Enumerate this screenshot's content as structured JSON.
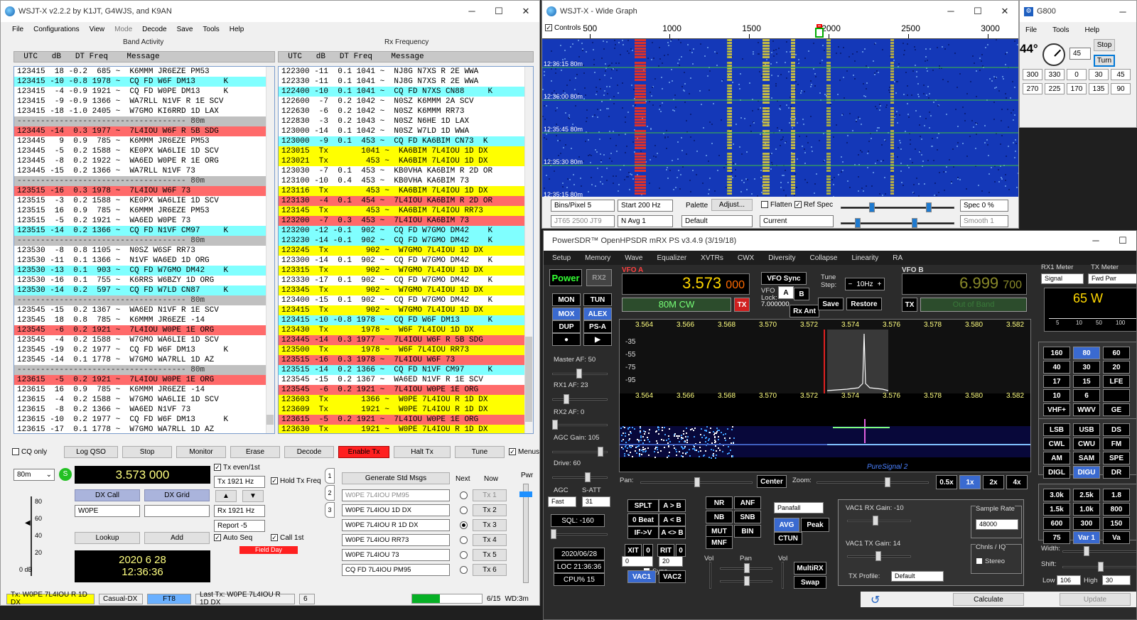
{
  "wsjt": {
    "title": "WSJT-X   v2.2.2   by K1JT, G4WJS, and K9AN",
    "menu": [
      "File",
      "Configurations",
      "View",
      "Mode",
      "Decode",
      "Save",
      "Tools",
      "Help"
    ],
    "band_activity_label": "Band Activity",
    "rx_frequency_label": "Rx Frequency",
    "col_header": "  UTC   dB   DT Freq    Message",
    "band_rows": [
      {
        "t": "123415  18 -0.2  685 ~  K6MMM JR6EZE PM53",
        "c": ""
      },
      {
        "t": "123415 -10 -0.8 1978 ~  CQ FD W6F DM13      K",
        "c": "cq"
      },
      {
        "t": "123415  -4 -0.9 1921 ~  CQ FD W0PE DM13     K",
        "c": ""
      },
      {
        "t": "123415  -9 -0.9 1366 ~  WA7RLL N1VF R 1E SCV",
        "c": ""
      },
      {
        "t": "123415 -18 -1.0 2405 ~  W7GMO KI6RRD 1D LAX",
        "c": ""
      },
      {
        "t": "------------------------------------ 80m",
        "c": "sep"
      },
      {
        "t": "123445 -14  0.3 1977 ~  7L4IOU W6F R 5B SDG",
        "c": "me"
      },
      {
        "t": "123445   9  0.9  785 ~  K6MMM JR6EZE PM53",
        "c": ""
      },
      {
        "t": "123445  -5  0.2 1588 ~  KE0PX WA6LIE 1D SCV",
        "c": ""
      },
      {
        "t": "123445  -8  0.2 1922 ~  WA6ED W0PE R 1E ORG",
        "c": ""
      },
      {
        "t": "123445 -15  0.2 1366 ~  WA7RLL N1VF 73",
        "c": ""
      },
      {
        "t": "------------------------------------ 80m",
        "c": "sep"
      },
      {
        "t": "123515 -16  0.3 1978 ~  7L4IOU W6F 73",
        "c": "me"
      },
      {
        "t": "123515  -3  0.2 1588 ~  KE0PX WA6LIE 1D SCV",
        "c": ""
      },
      {
        "t": "123515  16  0.9  785 ~  K6MMM JR6EZE PM53",
        "c": ""
      },
      {
        "t": "123515  -5  0.2 1921 ~  WA6ED W0PE 73",
        "c": ""
      },
      {
        "t": "123515 -14  0.2 1366 ~  CQ FD N1VF CM97     K",
        "c": "cq"
      },
      {
        "t": "------------------------------------ 80m",
        "c": "sep"
      },
      {
        "t": "123530  -8  0.8 1105 ~  N0SZ W6SF RR73",
        "c": ""
      },
      {
        "t": "123530 -11  0.1 1366 ~  N1VF WA6ED 1D ORG",
        "c": ""
      },
      {
        "t": "123530 -13  0.1  903 ~  CQ FD W7GMO DM42    K",
        "c": "cq"
      },
      {
        "t": "123530 -16  0.1  755 ~  K6RRS W6BZY 1D ORG",
        "c": ""
      },
      {
        "t": "123530 -14  0.2  597 ~  CQ FD W7LD CN87     K",
        "c": "cq"
      },
      {
        "t": "------------------------------------ 80m",
        "c": "sep"
      },
      {
        "t": "123545 -15  0.2 1367 ~  WA6ED N1VF R 1E SCV",
        "c": ""
      },
      {
        "t": "123545  18  0.8  785 ~  K6MMM JR6EZE -14",
        "c": ""
      },
      {
        "t": "123545  -6  0.2 1921 ~  7L4IOU W0PE 1E ORG",
        "c": "me"
      },
      {
        "t": "123545  -4  0.2 1588 ~  W7GMO WA6LIE 1D SCV",
        "c": ""
      },
      {
        "t": "123545 -19  0.2 1977 ~  CQ FD W6F DM13      K",
        "c": ""
      },
      {
        "t": "123545 -14  0.1 1778 ~  W7GMO WA7RLL 1D AZ",
        "c": ""
      },
      {
        "t": "------------------------------------ 80m",
        "c": "sep"
      },
      {
        "t": "123615  -5  0.2 1921 ~  7L4IOU W0PE 1E ORG",
        "c": "me"
      },
      {
        "t": "123615  16  0.9  785 ~  K6MMM JR6EZE -14",
        "c": ""
      },
      {
        "t": "123615  -4  0.2 1588 ~  W7GMO WA6LIE 1D SCV",
        "c": ""
      },
      {
        "t": "123615  -8  0.2 1366 ~  WA6ED N1VF 73",
        "c": ""
      },
      {
        "t": "123615 -10  0.2 1977 ~  CQ FD W6F DM13      K",
        "c": ""
      },
      {
        "t": "123615 -17  0.1 1778 ~  W7GMO WA7RLL 1D AZ",
        "c": ""
      }
    ],
    "rx_rows": [
      {
        "t": "122300 -11  0.1 1041 ~  NJ8G N7XS R 2E WWA",
        "c": ""
      },
      {
        "t": "122330 -11  0.1 1041 ~  NJ8G N7XS R 2E WWA",
        "c": ""
      },
      {
        "t": "122400 -10  0.1 1041 ~  CQ FD N7XS CN88     K",
        "c": "cq"
      },
      {
        "t": "122600  -7  0.2 1042 ~  N0SZ K6MMM 2A SCV",
        "c": ""
      },
      {
        "t": "122630  -6  0.2 1042 ~  N0SZ K6MMM RR73",
        "c": ""
      },
      {
        "t": "122830  -3  0.2 1043 ~  N0SZ N6HE 1D LAX",
        "c": ""
      },
      {
        "t": "123000 -14  0.1 1042 ~  N0SZ W7LD 1D WWA",
        "c": ""
      },
      {
        "t": "123000  -9  0.1  453 ~  CQ FD KA6BIM CN73  K",
        "c": "cq"
      },
      {
        "t": "123015  Tx       1041 ~  KA6BIM 7L4IOU 1D DX",
        "c": "tx"
      },
      {
        "t": "123021  Tx        453 ~  KA6BIM 7L4IOU 1D DX",
        "c": "tx"
      },
      {
        "t": "123030  -7  0.1  453 ~  KB0VHA KA6BIM R 2D OR",
        "c": ""
      },
      {
        "t": "123100 -10  0.4  453 ~  KB0VHA KA6BIM 73",
        "c": ""
      },
      {
        "t": "123116  Tx        453 ~  KA6BIM 7L4IOU 1D DX",
        "c": "tx"
      },
      {
        "t": "123130  -4  0.1  454 ~  7L4IOU KA6BIM R 2D OR",
        "c": "me"
      },
      {
        "t": "123145  Tx        453 ~  KA6BIM 7L4IOU RR73",
        "c": "tx"
      },
      {
        "t": "123200  -7  0.3  453 ~  7L4IOU KA6BIM 73",
        "c": "me"
      },
      {
        "t": "123200 -12 -0.1  902 ~  CQ FD W7GMO DM42    K",
        "c": "cq"
      },
      {
        "t": "123230 -14 -0.1  902 ~  CQ FD W7GMO DM42    K",
        "c": "cq"
      },
      {
        "t": "123245  Tx        902 ~  W7GMO 7L4IOU 1D DX",
        "c": "tx"
      },
      {
        "t": "123300 -14  0.1  902 ~  CQ FD W7GMO DM42    K",
        "c": ""
      },
      {
        "t": "123315  Tx        902 ~  W7GMO 7L4IOU 1D DX",
        "c": "tx"
      },
      {
        "t": "123330 -17  0.1  902 ~  CQ FD W7GMO DM42    K",
        "c": ""
      },
      {
        "t": "123345  Tx        902 ~  W7GMO 7L4IOU 1D DX",
        "c": "tx"
      },
      {
        "t": "123400 -15  0.1  902 ~  CQ FD W7GMO DM42    K",
        "c": ""
      },
      {
        "t": "123415  Tx        902 ~  W7GMO 7L4IOU 1D DX",
        "c": "tx"
      },
      {
        "t": "123415 -10 -0.8 1978 ~  CQ FD W6F DM13      K",
        "c": "cq"
      },
      {
        "t": "123430  Tx       1978 ~  W6F 7L4IOU 1D DX",
        "c": "tx"
      },
      {
        "t": "123445 -14  0.3 1977 ~  7L4IOU W6F R 5B SDG",
        "c": "me"
      },
      {
        "t": "123500  Tx       1978 ~  W6F 7L4IOU RR73",
        "c": "tx"
      },
      {
        "t": "123515 -16  0.3 1978 ~  7L4IOU W6F 73",
        "c": "me"
      },
      {
        "t": "123515 -14  0.2 1366 ~  CQ FD N1VF CM97     K",
        "c": "cq"
      },
      {
        "t": "123545 -15  0.2 1367 ~  WA6ED N1VF R 1E SCV",
        "c": ""
      },
      {
        "t": "123545  -6  0.2 1921 ~  7L4IOU W0PE 1E ORG",
        "c": "me"
      },
      {
        "t": "123603  Tx       1366 ~  W0PE 7L4IOU R 1D DX",
        "c": "tx"
      },
      {
        "t": "123609  Tx       1921 ~  W0PE 7L4IOU R 1D DX",
        "c": "tx"
      },
      {
        "t": "123615  -5  0.2 1921 ~  7L4IOU W0PE 1E ORG",
        "c": "me"
      },
      {
        "t": "123630  Tx       1921 ~  W0PE 7L4IOU R 1D DX",
        "c": "tx"
      }
    ],
    "buttons": {
      "cq_only": "CQ only",
      "log_qso": "Log QSO",
      "stop": "Stop",
      "monitor": "Monitor",
      "erase": "Erase",
      "decode": "Decode",
      "enable_tx": "Enable Tx",
      "halt_tx": "Halt Tx",
      "tune": "Tune",
      "menus": "Menus"
    },
    "band": "80m",
    "dial_freq": "3.573 000",
    "dx_call_label": "DX Call",
    "dx_grid_label": "DX Grid",
    "dx_call": "W0PE",
    "dx_grid": "",
    "lookup": "Lookup",
    "add": "Add",
    "date": "2020 6 28",
    "time": "12:36:36",
    "tx_even": "Tx even/1st",
    "tx_hz": "Tx  1921  Hz",
    "rx_hz": "Rx  1921  Hz",
    "hold_tx_freq": "Hold Tx Freq",
    "report": "Report -5",
    "auto_seq": "Auto Seq",
    "call_1st": "Call 1st",
    "field_day": "Field Day",
    "gen_std_msgs": "Generate Std Msgs",
    "next_label": "Next",
    "now_label": "Now",
    "pwr_label": "Pwr",
    "tx_msgs": [
      "W0PE 7L4IOU PM95",
      "W0PE 7L4IOU 1D DX",
      "W0PE 7L4IOU R 1D DX",
      "W0PE 7L4IOU RR73",
      "W0PE 7L4IOU 73",
      "CQ FD 7L4IOU PM95"
    ],
    "tx_btns": [
      "Tx 1",
      "Tx 2",
      "Tx 3",
      "Tx 4",
      "Tx 5",
      "Tx 6"
    ],
    "meter_ticks": [
      "80",
      "60",
      "40",
      "20",
      "0 dB"
    ],
    "side_tabs": [
      "1",
      "2",
      "3"
    ],
    "status": {
      "tx": "Tx: W0PE 7L4IOU R 1D DX",
      "config": "Casual-DX",
      "mode": "FT8",
      "last_tx": "Last Tx: W0PE 7L4IOU R 1D DX",
      "count": "6",
      "progress": "6/15",
      "wd": "WD:3m"
    }
  },
  "wide": {
    "title": "WSJT-X - Wide Graph",
    "controls": "Controls",
    "scale": [
      "500",
      "1000",
      "1500",
      "2000",
      "2500",
      "3000"
    ],
    "time_labels": [
      "12:36:15  80m",
      "12:36:00  80m",
      "12:35:45  80m",
      "12:35:30  80m",
      "12:35:15  80m"
    ],
    "bins": "Bins/Pixel  5",
    "start": "Start  200 Hz",
    "palette": "Palette",
    "adjust": "Adjust...",
    "flatten": "Flatten",
    "ref_spec": "Ref Spec",
    "spec": "Spec  0 %",
    "jt65": "JT65  2500  JT9",
    "navg": "N Avg  1",
    "default": "Default",
    "current": "Current",
    "smooth": "Smooth  1"
  },
  "g800": {
    "title": "G800",
    "menu": [
      "File",
      "Tools",
      "Help"
    ],
    "angle": "44°",
    "input": "45",
    "stop": "Stop",
    "turn": "Turn",
    "row1": [
      "300",
      "330",
      "0",
      "30",
      "45"
    ],
    "row2": [
      "270",
      "225",
      "170",
      "135",
      "90"
    ]
  },
  "psdr": {
    "title": "PowerSDR™ OpenHPSDR mRX PS v3.4.9 (3/19/18)",
    "menu": [
      "Setup",
      "Memory",
      "Wave",
      "Equalizer",
      "XVTRs",
      "CWX",
      "Diversity",
      "Collapse",
      "Linearity",
      "RA"
    ],
    "power": "Power",
    "rx2": "RX2",
    "mon": "MON",
    "tun": "TUN",
    "mox": "MOX",
    "alex": "ALEX",
    "dup": "DUP",
    "psa": "PS-A",
    "vfoa_label": "VFO A",
    "vfoa_freq": "3.573",
    "vfoa_sub": "000",
    "vfoa_mode": "80M CW",
    "tx": "TX",
    "vfo_sync": "VFO Sync",
    "vfo_lock": "VFO Lock:",
    "a": "A",
    "b": "B",
    "tune_step": "Tune Step:",
    "step_val": "10Hz",
    "lock_val": "7.000000",
    "rx_ant": "Rx Ant",
    "save": "Save",
    "restore": "Restore",
    "vfob_label": "VFO B",
    "vfob_freq": "6.999",
    "vfob_sub": "700",
    "out_of_band": "Out of Band",
    "rx1_meter": "RX1 Meter",
    "signal": "Signal",
    "tx_meter": "TX Meter",
    "fwd_pwr": "Fwd Pwr",
    "watts": "65 W",
    "freq_ticks": [
      "3.564",
      "3.566",
      "3.568",
      "3.570",
      "3.572",
      "3.574",
      "3.576",
      "3.578",
      "3.580",
      "3.582"
    ],
    "db_ticks": [
      "-35",
      "-55",
      "-75",
      "-95"
    ],
    "puresignal": "PureSignal 2",
    "master_af": "Master AF:  50",
    "rx1_af": "RX1 AF:  23",
    "rx2_af": "RX2 AF:  0",
    "agc_gain": "AGC Gain:  105",
    "drive": "Drive:  60",
    "agc": "AGC",
    "satt": "S-ATT",
    "fast": "Fast",
    "satt_val": "31",
    "sql": "SQL: -160",
    "date": "2020/06/28",
    "loc": "LOC 21:36:36",
    "cpu": "CPU%  15",
    "pan": "Pan:",
    "center": "Center",
    "zoom": "Zoom:",
    "zooms": [
      "0.5x",
      "1x",
      "2x",
      "4x"
    ],
    "splt": "SPLT",
    "atob": "A > B",
    "zbeat": "0 Beat",
    "altb": "A < B",
    "ifv": "IF->V",
    "aswap": "A <> B",
    "xit": "XIT",
    "xit_v": "0",
    "rit": "RIT",
    "rit_v": "0",
    "xit_num": "0",
    "rit_num": "20",
    "sync": "Sync",
    "vac1": "VAC1",
    "vac2": "VAC2",
    "nr": "NR",
    "anf": "ANF",
    "nb": "NB",
    "snb": "SNB",
    "mut": "MUT",
    "bin": "BIN",
    "mnf": "MNF",
    "panafall": "Panafall",
    "avg": "AVG",
    "peak": "Peak",
    "ctun": "CTUN",
    "multirx": "MultiRX",
    "swap": "Swap",
    "vol": "Vol",
    "pan2": "Pan",
    "vol2": "Vol",
    "vac_rx": "VAC1  RX Gain: -10",
    "vac_tx": "VAC1  TX Gain: 14",
    "tx_profile": "TX Profile:",
    "profile_val": "Default",
    "sample_rate": "Sample Rate",
    "sr_val": "48000",
    "chnls": "Chnls / IQ",
    "stereo": "Stereo",
    "bands": [
      "160",
      "80",
      "60",
      "40",
      "30",
      "20",
      "17",
      "15",
      "LFE",
      "10",
      "6",
      "",
      "VHF+",
      "WWV",
      "GE"
    ],
    "modes": [
      "LSB",
      "USB",
      "DS",
      "CWL",
      "CWU",
      "FM",
      "AM",
      "SAM",
      "SPE",
      "DIGL",
      "DIGU",
      "DR"
    ],
    "filters": [
      "3.0k",
      "2.5k",
      "1.8",
      "1.5k",
      "1.0k",
      "800",
      "600",
      "300",
      "150",
      "75",
      "Var 1",
      "Va"
    ],
    "width": "Width:",
    "shift": "Shift:",
    "low": "Low",
    "low_v": "106",
    "high": "High",
    "high_v": "30",
    "calc": "Calculate",
    "update": "Update",
    "meter_scale": [
      "5",
      "10",
      "50",
      "100"
    ]
  }
}
